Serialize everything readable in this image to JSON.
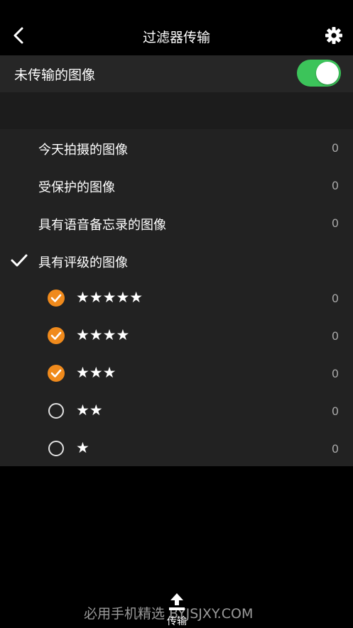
{
  "header": {
    "title": "过滤器传输",
    "back_icon": "chevron-left-icon",
    "settings_icon": "gear-icon"
  },
  "untransferred": {
    "label": "未传输的图像",
    "enabled": true,
    "toggle_color": "#3cc45a"
  },
  "filters": [
    {
      "label": "今天拍摄的图像",
      "count": "0",
      "checked": false
    },
    {
      "label": "受保护的图像",
      "count": "0",
      "checked": false
    },
    {
      "label": "具有语音备忘录的图像",
      "count": "0",
      "checked": false
    },
    {
      "label": "具有评级的图像",
      "count": "",
      "checked": true
    }
  ],
  "ratings": [
    {
      "stars": "★★★★★",
      "count": "0",
      "selected": true
    },
    {
      "stars": "★★★★",
      "count": "0",
      "selected": true
    },
    {
      "stars": "★★★",
      "count": "0",
      "selected": true
    },
    {
      "stars": "★★",
      "count": "0",
      "selected": false
    },
    {
      "stars": "★",
      "count": "0",
      "selected": false
    }
  ],
  "accent_color": "#f08a1c",
  "footer": {
    "upload_label": "传输",
    "upload_icon": "upload-icon",
    "watermark": "必用手机精选 BYJSJXY.COM"
  }
}
